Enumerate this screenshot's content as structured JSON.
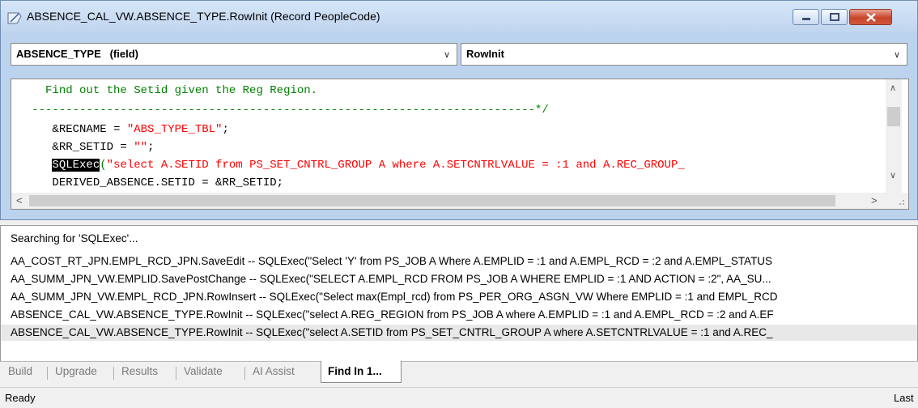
{
  "window": {
    "title": "ABSENCE_CAL_VW.ABSENCE_TYPE.RowInit (Record PeopleCode)",
    "field_dropdown": "ABSENCE_TYPE   (field)",
    "event_dropdown": "RowInit"
  },
  "editor": {
    "lines": [
      {
        "indent": "     ",
        "parts": [
          {
            "t": "Find out the Setid given the Reg Region.",
            "c": "#008000"
          }
        ]
      },
      {
        "indent": "   ",
        "parts": [
          {
            "t": "--------------------------------------------------------------------------*/",
            "c": "#008000"
          }
        ]
      },
      {
        "indent": "      ",
        "parts": [
          {
            "t": "&RECNAME = ",
            "c": "#000000"
          },
          {
            "t": "\"ABS_TYPE_TBL\"",
            "c": "#ff0000"
          },
          {
            "t": ";",
            "c": "#000000"
          }
        ]
      },
      {
        "indent": "      ",
        "parts": [
          {
            "t": "&RR_SETID = ",
            "c": "#000000"
          },
          {
            "t": "\"\"",
            "c": "#ff0000"
          },
          {
            "t": ";",
            "c": "#000000"
          }
        ]
      },
      {
        "indent": "      ",
        "parts": [
          {
            "t": "SQLExec",
            "c": "#ffffff",
            "bg": "#000000"
          },
          {
            "t": "(",
            "c": "#008000"
          },
          {
            "t": "\"select A.SETID from PS_SET_CNTRL_GROUP A where A.SETCNTRLVALUE = :1 and A.REC_GROUP_",
            "c": "#ff0000"
          }
        ]
      },
      {
        "indent": "      ",
        "parts": [
          {
            "t": "DERIVED_ABSENCE.SETID = &RR_SETID;",
            "c": "#000000"
          }
        ]
      }
    ]
  },
  "results": {
    "searching": "Searching for 'SQLExec'...",
    "rows": [
      "AA_COST_RT_JPN.EMPL_RCD_JPN.SaveEdit -- SQLExec(\"Select 'Y' from PS_JOB A Where A.EMPLID = :1 and A.EMPL_RCD = :2 and A.EMPL_STATUS",
      "AA_SUMM_JPN_VW.EMPLID.SavePostChange -- SQLExec(\"SELECT A.EMPL_RCD FROM PS_JOB A WHERE EMPLID = :1 AND ACTION = :2\", AA_SU...",
      "AA_SUMM_JPN_VW.EMPL_RCD_JPN.RowInsert -- SQLExec(\"Select max(Empl_rcd) from PS_PER_ORG_ASGN_VW Where EMPLID = :1 and EMPL_RCD",
      "ABSENCE_CAL_VW.ABSENCE_TYPE.RowInit -- SQLExec(\"select A.REG_REGION from PS_JOB A where A.EMPLID = :1 and A.EMPL_RCD = :2 and A.EF",
      "ABSENCE_CAL_VW.ABSENCE_TYPE.RowInit -- SQLExec(\"select A.SETID from PS_SET_CNTRL_GROUP A where A.SETCNTRLVALUE = :1 and A.REC_"
    ],
    "selected_index": 4
  },
  "tabs": [
    "Build",
    "Upgrade",
    "Results",
    "Validate",
    "AI Assist",
    "Find In 1..."
  ],
  "status": {
    "left": "Ready",
    "right": "Last"
  },
  "colors": {
    "comment": "#008000",
    "string": "#ff0000",
    "title_bg": "#bfd4ee",
    "close_button": "#c8452c"
  },
  "icons": [
    "peoplecode-icon",
    "minimize-icon",
    "maximize-icon",
    "close-icon",
    "chevron-down-icon",
    "scroll-up-icon",
    "scroll-down-icon",
    "scroll-left-icon",
    "scroll-right-icon",
    "resize-grip-icon"
  ]
}
